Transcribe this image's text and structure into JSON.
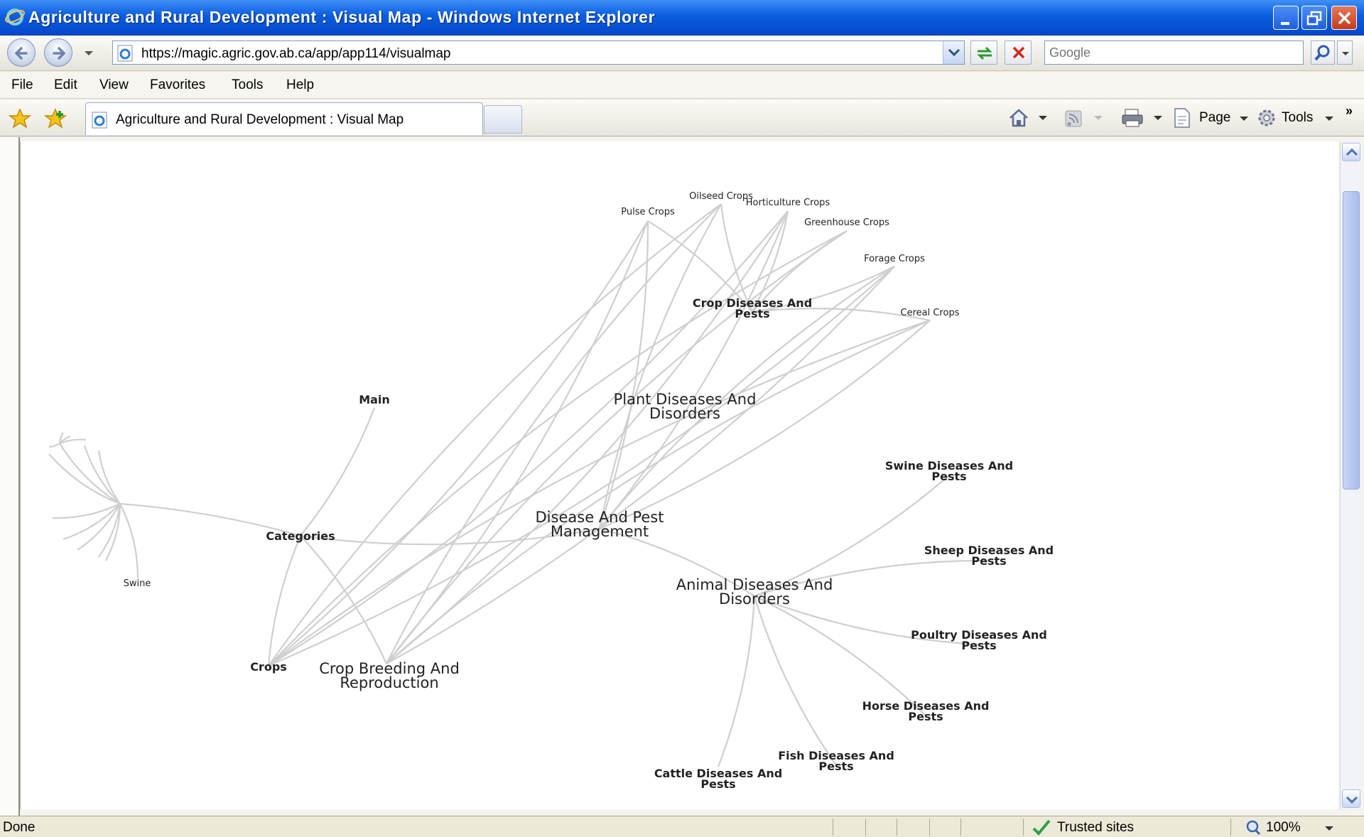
{
  "window": {
    "title": "Agriculture and Rural Development : Visual Map - Windows Internet Explorer"
  },
  "address_bar": {
    "url": "https://magic.agric.gov.ab.ca/app/app114/visualmap",
    "search_placeholder": "Google"
  },
  "menu": [
    "File",
    "Edit",
    "View",
    "Favorites",
    "Tools",
    "Help"
  ],
  "tabs": {
    "active_label": "Agriculture and Rural Development : Visual Map"
  },
  "command_bar": {
    "page_label": "Page",
    "tools_label": "Tools",
    "more_chevron": "»"
  },
  "icons": [
    "ie-logo-icon",
    "minimize-icon",
    "restore-icon",
    "close-icon",
    "back-icon",
    "forward-icon",
    "refresh-icon",
    "stop-icon",
    "search-icon",
    "favorites-star-icon",
    "add-favorites-icon",
    "home-icon",
    "feeds-icon",
    "print-icon",
    "page-icon",
    "tools-gear-icon",
    "trusted-check-icon",
    "zoom-icon"
  ],
  "visual_map": {
    "nodes": [
      {
        "id": "main",
        "label": "Main",
        "color": "#2b3fd6",
        "bold": true
      },
      {
        "id": "categories",
        "label": "Categories",
        "bold": true
      },
      {
        "id": "swine_left",
        "label": "Swine"
      },
      {
        "id": "crops",
        "label": "Crops",
        "bold": true
      },
      {
        "id": "crop_breeding",
        "label": "Crop Breeding And Reproduction"
      },
      {
        "id": "disease_pest",
        "label": "Disease And Pest Management"
      },
      {
        "id": "plant_diseases",
        "label": "Plant Diseases And Disorders"
      },
      {
        "id": "crop_diseases",
        "label": "Crop Diseases And Pests",
        "bold": true
      },
      {
        "id": "pulse",
        "label": "Pulse Crops"
      },
      {
        "id": "oilseed",
        "label": "Oilseed Crops"
      },
      {
        "id": "horticulture",
        "label": "Horticulture Crops"
      },
      {
        "id": "greenhouse",
        "label": "Greenhouse Crops"
      },
      {
        "id": "forage",
        "label": "Forage Crops"
      },
      {
        "id": "cereal",
        "label": "Cereal Crops"
      },
      {
        "id": "animal_diseases",
        "label": "Animal Diseases And Disorders"
      },
      {
        "id": "swine_d",
        "label": "Swine Diseases And Pests",
        "bold": true
      },
      {
        "id": "sheep_d",
        "label": "Sheep Diseases And Pests",
        "bold": true
      },
      {
        "id": "poultry_d",
        "label": "Poultry Diseases And Pests",
        "bold": true
      },
      {
        "id": "horse_d",
        "label": "Horse Diseases And Pests",
        "bold": true
      },
      {
        "id": "fish_d",
        "label": "Fish Diseases And Pests",
        "bold": true
      },
      {
        "id": "cattle_d",
        "label": "Cattle Diseases And Pests",
        "bold": true
      }
    ],
    "edges": [
      [
        "main",
        "categories"
      ],
      [
        "categories",
        "crops"
      ],
      [
        "categories",
        "crop_breeding"
      ],
      [
        "categories",
        "disease_pest"
      ],
      [
        "disease_pest",
        "animal_diseases"
      ],
      [
        "animal_diseases",
        "swine_d"
      ],
      [
        "animal_diseases",
        "sheep_d"
      ],
      [
        "animal_diseases",
        "poultry_d"
      ],
      [
        "animal_diseases",
        "horse_d"
      ],
      [
        "animal_diseases",
        "fish_d"
      ],
      [
        "animal_diseases",
        "cattle_d"
      ],
      [
        "crop_diseases",
        "pulse"
      ],
      [
        "crop_diseases",
        "oilseed"
      ],
      [
        "crop_diseases",
        "horticulture"
      ],
      [
        "crop_diseases",
        "greenhouse"
      ],
      [
        "crop_diseases",
        "forage"
      ],
      [
        "crop_diseases",
        "cereal"
      ],
      [
        "crops",
        "pulse"
      ],
      [
        "crops",
        "oilseed"
      ],
      [
        "crops",
        "horticulture"
      ],
      [
        "crops",
        "greenhouse"
      ],
      [
        "crops",
        "forage"
      ],
      [
        "crops",
        "cereal"
      ],
      [
        "crop_breeding",
        "pulse"
      ],
      [
        "crop_breeding",
        "oilseed"
      ],
      [
        "crop_breeding",
        "horticulture"
      ],
      [
        "crop_breeding",
        "greenhouse"
      ],
      [
        "crop_breeding",
        "forage"
      ],
      [
        "crop_breeding",
        "cereal"
      ],
      [
        "disease_pest",
        "pulse"
      ],
      [
        "disease_pest",
        "oilseed"
      ],
      [
        "disease_pest",
        "horticulture"
      ],
      [
        "disease_pest",
        "forage"
      ],
      [
        "disease_pest",
        "cereal"
      ]
    ]
  },
  "status_bar": {
    "status": "Done",
    "zone": "Trusted sites",
    "zoom": "100%"
  }
}
